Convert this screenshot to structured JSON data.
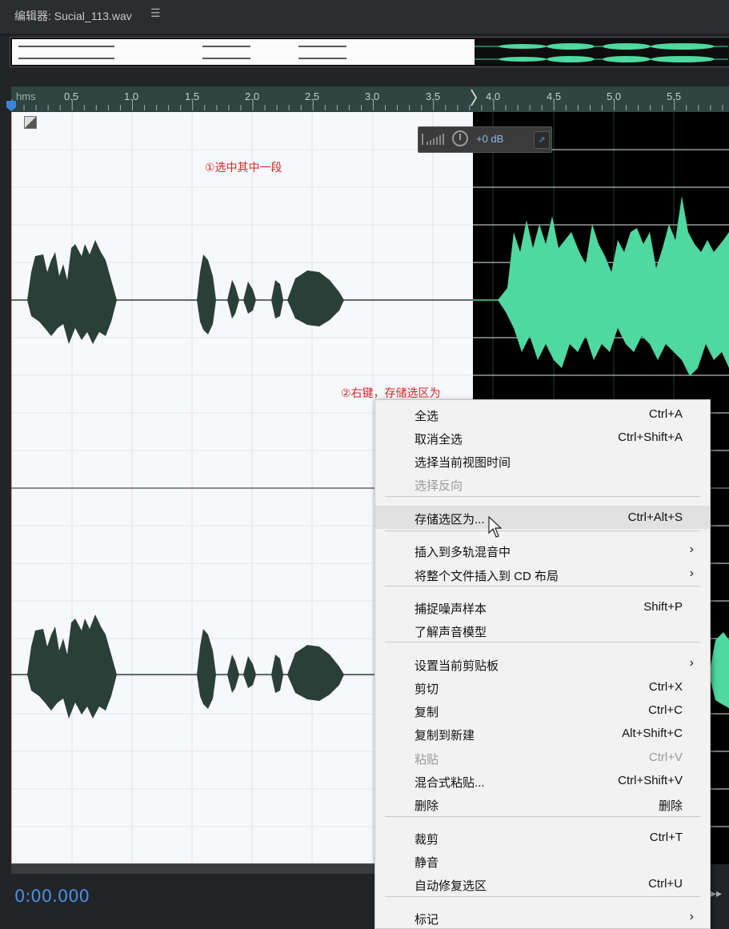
{
  "window": {
    "title": "编辑器: Sucial_113.wav",
    "menu_glyph": "☰"
  },
  "ruler": {
    "unit": "hms",
    "ticks": [
      "0.5",
      "1.0",
      "1.5",
      "2.0",
      "2.5",
      "3.0",
      "3.5",
      "4.0",
      "4.5",
      "5.0",
      "5.5"
    ]
  },
  "hud": {
    "gain": "+0 dB",
    "pin_glyph": "⇗"
  },
  "annotations": {
    "step1": "①选中其中一段",
    "step2": "②右键，存储选区为"
  },
  "timecode": "0:00.000",
  "transport_glyph": "▸▸",
  "colors": {
    "selection_bg": "#fbfbfb",
    "waveform_selected": "#2a3f38",
    "waveform_unselected": "#4fd8a0",
    "timecode": "#4a90e2",
    "annotation": "#d8252a"
  },
  "context_menu": {
    "items": [
      {
        "label": "全选",
        "shortcut": "Ctrl+A"
      },
      {
        "label": "取消全选",
        "shortcut": "Ctrl+Shift+A"
      },
      {
        "label": "选择当前视图时间",
        "shortcut": ""
      },
      {
        "label": "选择反向",
        "shortcut": "",
        "disabled": true
      },
      {
        "label": "存储选区为...",
        "shortcut": "Ctrl+Alt+S",
        "highlighted": true
      },
      {
        "label": "插入到多轨混音中",
        "shortcut": "",
        "submenu": true
      },
      {
        "label": "将整个文件插入到 CD 布局",
        "shortcut": "",
        "submenu": true
      },
      {
        "label": "捕捉噪声样本",
        "shortcut": "Shift+P"
      },
      {
        "label": "了解声音模型",
        "shortcut": ""
      },
      {
        "label": "设置当前剪贴板",
        "shortcut": "",
        "submenu": true
      },
      {
        "label": "剪切",
        "shortcut": "Ctrl+X"
      },
      {
        "label": "复制",
        "shortcut": "Ctrl+C"
      },
      {
        "label": "复制到新建",
        "shortcut": "Alt+Shift+C"
      },
      {
        "label": "粘贴",
        "shortcut": "Ctrl+V",
        "disabled": true
      },
      {
        "label": "混合式粘贴...",
        "shortcut": "Ctrl+Shift+V"
      },
      {
        "label": "删除",
        "shortcut": "删除"
      },
      {
        "label": "裁剪",
        "shortcut": "Ctrl+T"
      },
      {
        "label": "静音",
        "shortcut": ""
      },
      {
        "label": "自动修复选区",
        "shortcut": "Ctrl+U"
      },
      {
        "label": "标记",
        "shortcut": "",
        "submenu": true
      }
    ],
    "submenu_glyph": "›"
  }
}
